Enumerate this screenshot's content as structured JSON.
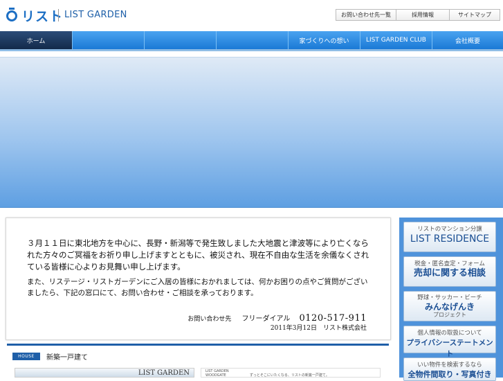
{
  "header": {
    "logo_brand": "リスト",
    "logo_sub": "LIST GARDEN",
    "util_links": [
      "お問い合わせ先一覧",
      "採用情報",
      "サイトマップ"
    ]
  },
  "nav": {
    "items": [
      "ホーム",
      "",
      "",
      "",
      "家づくりへの想い",
      "LIST GARDEN CLUB",
      "会社概要"
    ]
  },
  "notice": {
    "paragraph1": "３月１１日に東北地方を中心に、長野・新潟等で発生致しました大地震と津波等により亡くなられた方々のご冥福をお祈り申し上げますとともに、被災され、現在不自由な生活を余儀なくされている皆様に心よりお見舞い申し上げます。",
    "paragraph2": "また、リステージ・リストガーデンにご入居の皆様におかれましては、何かお困りの点やご質問がございましたら、下記の窓口にて、お問い合わせ・ご相談を承っております。",
    "contact_label": "お問い合わせ先",
    "contact_free": "フリーダイアル",
    "contact_number": "0120-517-911",
    "date_signature": "2011年3月12日　リスト株式会社"
  },
  "house": {
    "badge": "HOUSE",
    "title": "新築一戸建て",
    "card1_label": "LIST GARDEN",
    "card2_logo_line1": "LIST GARDEN",
    "card2_logo_line2": "WOODGATE",
    "card2_text": "ずっとそこにいたくなる、リストの新築一戸建て。"
  },
  "sidebar": {
    "buttons": [
      {
        "sub": "リストのマンション分譲",
        "main": "LIST RESIDENCE",
        "small": ""
      },
      {
        "sub": "税金・匿名査定・フォーム",
        "main": "売却に関する相談",
        "small": ""
      },
      {
        "sub": "野球・サッカー・ビーチ",
        "main": "みんなげんき",
        "small": "プロジェクト"
      },
      {
        "sub": "個人情報の取扱について",
        "main": "プライバシーステートメント",
        "small": ""
      },
      {
        "sub": "いい物件を検索するなら",
        "main": "全物件間取り・写真付き",
        "small": ""
      }
    ]
  },
  "colors": {
    "brand_blue": "#1d6fc4",
    "nav_blue": "#1a79d6",
    "nav_active": "#132a4a",
    "sidebar_blue": "#4f93db"
  }
}
